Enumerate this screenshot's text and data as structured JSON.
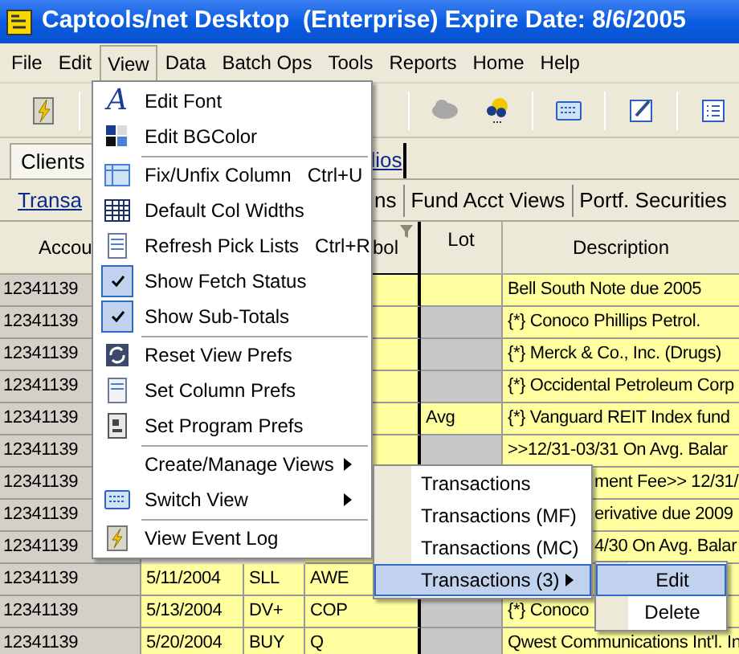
{
  "window": {
    "title": "Captools/net Desktop  (Enterprise) Expire Date: 8/6/2005"
  },
  "menu_bar": [
    {
      "label": "File",
      "selected": false
    },
    {
      "label": "Edit",
      "selected": false
    },
    {
      "label": "View",
      "selected": true
    },
    {
      "label": "Data",
      "selected": false
    },
    {
      "label": "Batch Ops",
      "selected": false
    },
    {
      "label": "Tools",
      "selected": false
    },
    {
      "label": "Reports",
      "selected": false
    },
    {
      "label": "Home",
      "selected": false
    },
    {
      "label": "Help",
      "selected": false
    }
  ],
  "tabs": [
    {
      "label": "Clients"
    },
    {
      "label": "lios"
    }
  ],
  "sub_tabs": [
    {
      "label": "Transa",
      "kind": "link"
    },
    {
      "label": "ns",
      "kind": "plain"
    },
    {
      "label": "Fund Acct Views",
      "kind": "plain"
    },
    {
      "label": "Portf. Securities",
      "kind": "plain"
    }
  ],
  "table": {
    "columns": [
      "Accou",
      "bol",
      "Lot",
      "Description"
    ],
    "rows": [
      {
        "account": "12341139",
        "lot_disabled": false,
        "description": "Bell South Note due 2005",
        "kind": "normal"
      },
      {
        "account": "12341139",
        "lot_disabled": true,
        "description": "{*} Conoco Phillips Petrol.",
        "kind": "normal"
      },
      {
        "account": "12341139",
        "lot_disabled": true,
        "description": "{*} Merck & Co., Inc. (Drugs)",
        "kind": "normal"
      },
      {
        "account": "12341139",
        "lot_disabled": true,
        "description": "{*} Occidental Petroleum Corp",
        "kind": "normal"
      },
      {
        "account": "12341139",
        "lot": "Avg",
        "lot_disabled": false,
        "description": "{*} Vanguard REIT Index fund",
        "kind": "normal"
      },
      {
        "account": "12341139",
        "lot_disabled": true,
        "description": ">>12/31-03/31 On Avg. Balar",
        "kind": "normal"
      },
      {
        "account": "12341139",
        "description": "ment Fee>> 12/31/",
        "kind": "covered"
      },
      {
        "account": "12341139",
        "description": "erivative due 2009",
        "kind": "covered"
      },
      {
        "account": "12341139",
        "description": "4/30 On Avg. Balar",
        "kind": "covered"
      },
      {
        "account": "12341139",
        "date": "5/11/2004",
        "type": "SLL",
        "symbol": "AWE",
        "kind": "normal"
      },
      {
        "account": "12341139",
        "date": "5/13/2004",
        "type": "DV+",
        "symbol": "COP",
        "lot_disabled": true,
        "description": "{*} Conoco",
        "kind": "normal"
      },
      {
        "account": "12341139",
        "date": "5/20/2004",
        "type": "BUY",
        "symbol": "Q",
        "lot_disabled": true,
        "description": "Qwest Communications Int'l. In",
        "kind": "normal"
      }
    ]
  },
  "view_menu": [
    {
      "kind": "item",
      "label": "Edit Font",
      "icon_text": "A",
      "checked": false,
      "submenu": false
    },
    {
      "kind": "item",
      "label": "Edit BGColor",
      "checked": false,
      "submenu": false
    },
    {
      "kind": "separator"
    },
    {
      "kind": "item",
      "label": "Fix/Unfix Column",
      "shortcut": "Ctrl+U",
      "checked": false,
      "submenu": false
    },
    {
      "kind": "item",
      "label": "Default Col Widths",
      "checked": false,
      "submenu": false
    },
    {
      "kind": "item",
      "label": "Refresh Pick Lists",
      "shortcut": "Ctrl+R",
      "checked": false,
      "submenu": false
    },
    {
      "kind": "item",
      "label": "Show Fetch Status",
      "checked": true,
      "submenu": false
    },
    {
      "kind": "item",
      "label": "Show Sub-Totals",
      "checked": true,
      "submenu": false
    },
    {
      "kind": "separator"
    },
    {
      "kind": "item",
      "label": "Reset View Prefs",
      "checked": false,
      "submenu": false
    },
    {
      "kind": "item",
      "label": "Set Column Prefs",
      "checked": false,
      "submenu": false
    },
    {
      "kind": "item",
      "label": "Set Program Prefs",
      "checked": false,
      "submenu": false
    },
    {
      "kind": "separator"
    },
    {
      "kind": "item",
      "label": "Create/Manage Views",
      "checked": false,
      "submenu": true
    },
    {
      "kind": "item",
      "label": "Switch View",
      "checked": false,
      "submenu": true
    },
    {
      "kind": "separator"
    },
    {
      "kind": "item",
      "label": "View Event Log",
      "checked": false,
      "submenu": false
    }
  ],
  "views_submenu": [
    {
      "label": "Transactions",
      "selected": false,
      "submenu": false
    },
    {
      "label": "Transactions (MF)",
      "selected": false,
      "submenu": false
    },
    {
      "label": "Transactions (MC)",
      "selected": false,
      "submenu": false
    },
    {
      "label": "Transactions (3)",
      "selected": true,
      "submenu": true
    }
  ],
  "view_actions_submenu": [
    {
      "label": "Edit",
      "selected": true
    },
    {
      "label": "Delete",
      "selected": false
    }
  ]
}
